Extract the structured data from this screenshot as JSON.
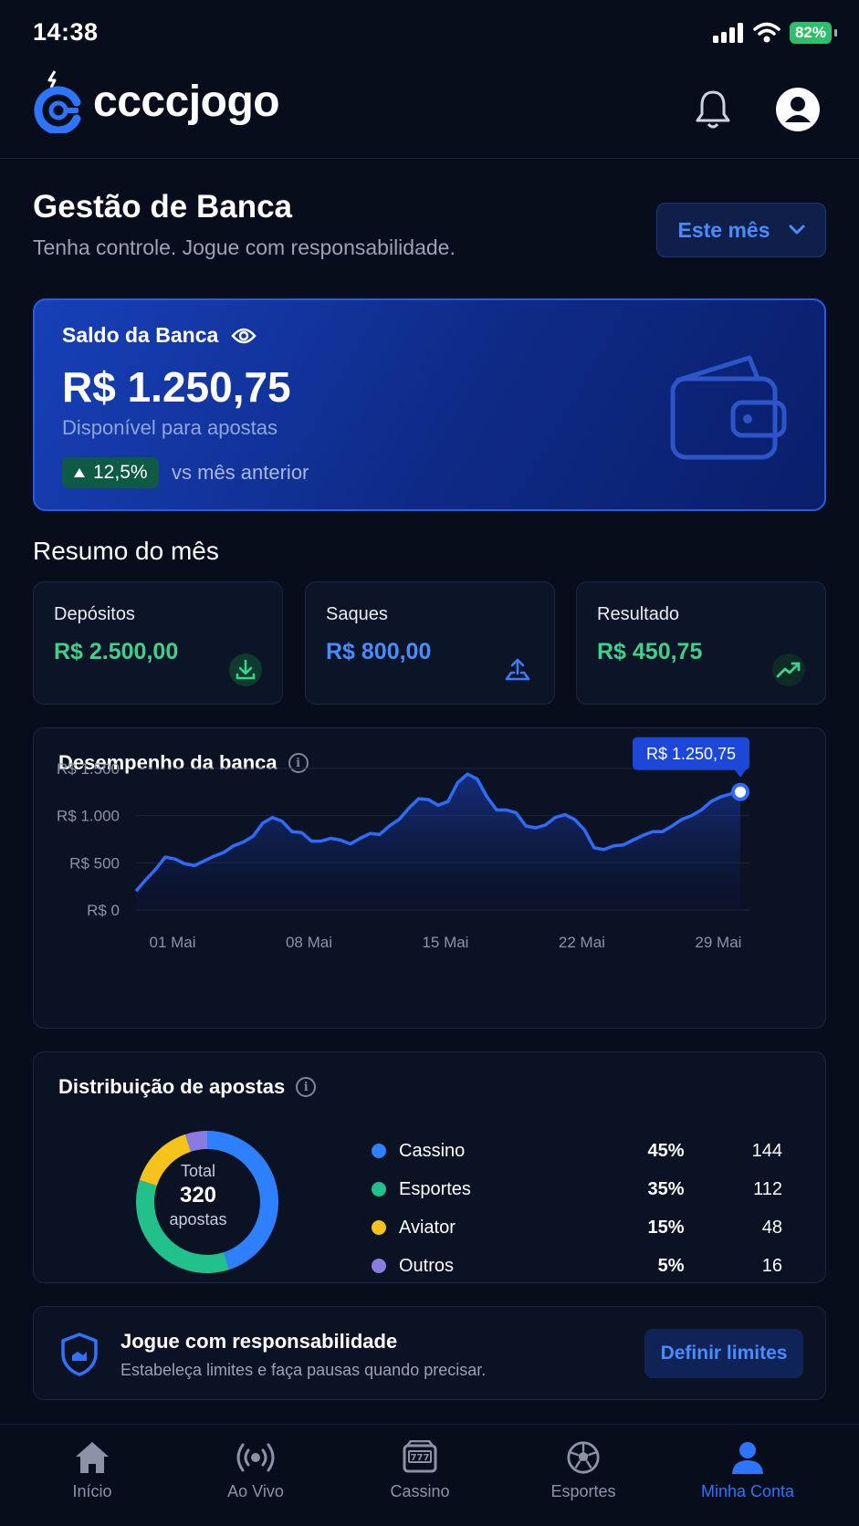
{
  "status_bar": {
    "time": "14:38",
    "battery": "82%"
  },
  "header": {
    "brand": "ccccjogo"
  },
  "page": {
    "title": "Gestão de Banca",
    "subtitle": "Tenha controle. Jogue com responsabilidade.",
    "period_selector": "Este mês"
  },
  "balance": {
    "label": "Saldo da Banca",
    "value": "R$ 1.250,75",
    "caption": "Disponível para apostas",
    "trend_value": "12,5%",
    "trend_text": "vs mês anterior"
  },
  "summary": {
    "title": "Resumo do mês",
    "cards": [
      {
        "label": "Depósitos",
        "value": "R$ 2.500,00",
        "color": "#3fd08a",
        "icon": "download-icon"
      },
      {
        "label": "Saques",
        "value": "R$ 800,00",
        "color": "#4a8cff",
        "icon": "withdraw-icon"
      },
      {
        "label": "Resultado",
        "value": "R$ 450,75",
        "color": "#3fd08a",
        "icon": "trend-up-icon"
      }
    ]
  },
  "performance": {
    "title": "Desempenho da banca",
    "tooltip": "R$ 1.250,75"
  },
  "chart_data": {
    "type": "area",
    "y_ticks": [
      "R$ 1.500",
      "R$ 1.000",
      "R$ 500",
      "R$ 0"
    ],
    "x_ticks": [
      "01 Mai",
      "08 Mai",
      "15 Mai",
      "22 Mai",
      "29 Mai"
    ],
    "ylim": [
      0,
      1500
    ],
    "x": [
      0,
      0.5,
      1,
      1.5,
      2,
      2.5,
      3,
      3.5,
      4,
      4.5,
      5,
      5.5,
      6,
      6.5,
      7,
      7.5,
      8,
      8.5,
      9,
      9.5,
      10,
      10.5,
      11,
      11.5,
      12,
      12.5,
      13,
      13.5,
      14,
      14.5,
      15,
      15.5,
      16,
      16.5,
      17,
      17.5,
      18,
      18.5,
      19,
      19.5,
      20,
      20.5,
      21,
      21.5,
      22,
      22.5,
      23,
      23.5,
      24,
      24.5,
      25,
      25.5,
      26,
      26.5,
      27,
      27.5,
      28,
      28.5,
      29,
      29.5,
      30,
      30.5,
      31
    ],
    "values": [
      200,
      320,
      430,
      560,
      540,
      490,
      470,
      520,
      570,
      610,
      680,
      720,
      780,
      920,
      980,
      940,
      830,
      820,
      730,
      730,
      760,
      740,
      700,
      760,
      810,
      800,
      890,
      960,
      1080,
      1180,
      1170,
      1110,
      1150,
      1350,
      1440,
      1390,
      1200,
      1060,
      1060,
      1030,
      890,
      870,
      900,
      980,
      1010,
      960,
      850,
      660,
      640,
      680,
      690,
      740,
      790,
      830,
      830,
      890,
      960,
      1000,
      1060,
      1150,
      1200,
      1230,
      1250
    ],
    "highlight": {
      "x": 31,
      "y": 1250.75
    }
  },
  "distribution": {
    "title": "Distribuição de apostas",
    "total_label": "Total",
    "total_value": "320",
    "total_unit": "apostas",
    "items": [
      {
        "name": "Cassino",
        "pct": "45%",
        "count": "144",
        "color": "#2f80ff",
        "share": 45
      },
      {
        "name": "Esportes",
        "pct": "35%",
        "count": "112",
        "color": "#22c08a",
        "share": 35
      },
      {
        "name": "Aviator",
        "pct": "15%",
        "count": "48",
        "color": "#f6c21c",
        "share": 15
      },
      {
        "name": "Outros",
        "pct": "5%",
        "count": "16",
        "color": "#8b7be0",
        "share": 5
      }
    ]
  },
  "responsible": {
    "title": "Jogue com responsabilidade",
    "subtitle": "Estabeleça limites e faça pausas quando precisar.",
    "button": "Definir limites"
  },
  "nav": [
    {
      "label": "Início",
      "icon": "home-icon"
    },
    {
      "label": "Ao Vivo",
      "icon": "live-icon"
    },
    {
      "label": "Cassino",
      "icon": "slot-machine-icon"
    },
    {
      "label": "Esportes",
      "icon": "soccer-ball-icon"
    },
    {
      "label": "Minha Conta",
      "icon": "user-icon",
      "active": true
    }
  ]
}
